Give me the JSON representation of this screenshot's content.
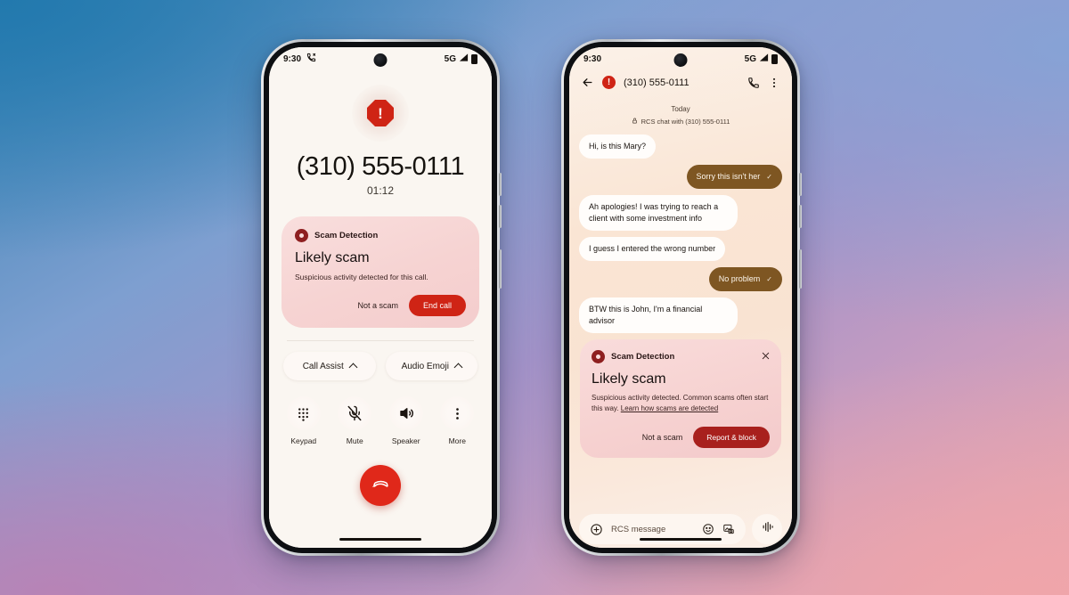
{
  "scene": {
    "background_colors": [
      "#2279ae",
      "#85a3d6",
      "#ba82b4",
      "#f0a5aa"
    ]
  },
  "phone_call": {
    "status_bar": {
      "time": "9:30",
      "call_icon": "active-call-icon",
      "network": "5G",
      "signal_icon": "signal-bars-icon",
      "battery_icon": "battery-icon"
    },
    "warning_icon": "octagon-warning-icon",
    "warning_glyph": "!",
    "number": "(310) 555-0111",
    "duration": "01:12",
    "scam_card": {
      "icon": "scam-detection-shield-icon",
      "label": "Scam Detection",
      "title": "Likely scam",
      "description": "Suspicious activity detected for this call.",
      "secondary_action": "Not a scam",
      "primary_action": "End call",
      "accent_color": "#cf2415",
      "background_color": "#f6d3d2"
    },
    "chips": [
      {
        "label": "Call Assist",
        "icon": "chevron-up-icon"
      },
      {
        "label": "Audio Emoji",
        "icon": "chevron-up-icon"
      }
    ],
    "controls": [
      {
        "label": "Keypad",
        "icon": "keypad-icon"
      },
      {
        "label": "Mute",
        "icon": "mute-off-icon"
      },
      {
        "label": "Speaker",
        "icon": "speaker-icon"
      },
      {
        "label": "More",
        "icon": "more-vertical-icon"
      }
    ],
    "end_call": {
      "icon": "hangup-icon",
      "color": "#e0281a"
    }
  },
  "phone_chat": {
    "status_bar": {
      "time": "9:30",
      "network": "5G",
      "signal_icon": "signal-bars-icon",
      "battery_icon": "battery-icon"
    },
    "header": {
      "back_icon": "back-arrow-icon",
      "avatar_icon": "warning-avatar-icon",
      "avatar_glyph": "!",
      "number": "(310) 555-0111",
      "call_icon": "phone-call-icon",
      "menu_icon": "more-vertical-icon"
    },
    "day_label": "Today",
    "rcs_note": "RCS chat with (310) 555-0111",
    "rcs_note_icon": "lock-icon",
    "messages": [
      {
        "direction": "in",
        "text": "Hi, is this Mary?"
      },
      {
        "direction": "out",
        "text": "Sorry this isn't her",
        "status_icon": "delivered-check-icon"
      },
      {
        "direction": "in",
        "text": "Ah apologies! I was trying to reach a client with some investment info"
      },
      {
        "direction": "in",
        "text": "I guess I entered the wrong number"
      },
      {
        "direction": "out",
        "text": "No problem",
        "status_icon": "delivered-check-icon"
      },
      {
        "direction": "in",
        "text": "BTW this is John, I'm a financial advisor"
      }
    ],
    "scam_card": {
      "icon": "scam-detection-shield-icon",
      "label": "Scam Detection",
      "close_icon": "close-icon",
      "title": "Likely scam",
      "description": "Suspicious activity detected. Common scams often start this way.",
      "link_text": "Learn how scams are detected",
      "secondary_action": "Not a scam",
      "primary_action": "Report & block",
      "accent_color": "#a8201d"
    },
    "composer": {
      "add_icon": "plus-circle-icon",
      "placeholder": "RCS message",
      "emoji_icon": "emoji-icon",
      "gallery_icon": "gallery-icon",
      "mic_icon": "audio-waveform-icon"
    }
  }
}
